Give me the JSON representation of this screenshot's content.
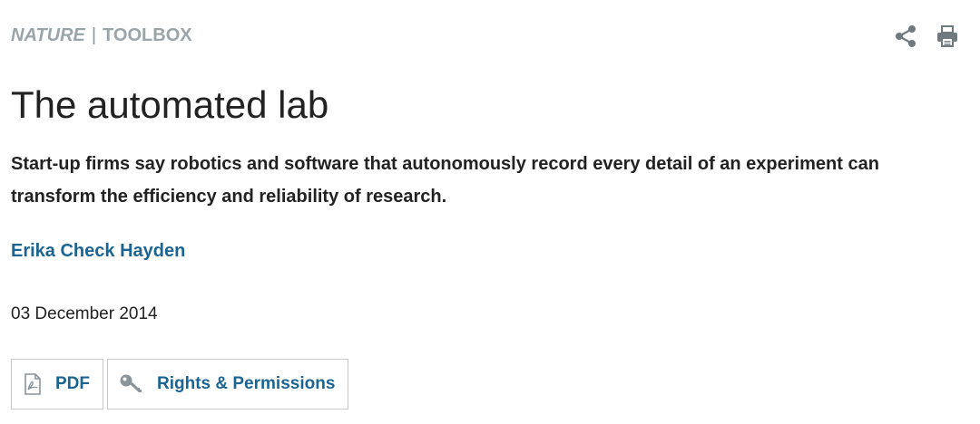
{
  "header": {
    "journal": "NATURE",
    "separator": "|",
    "section": "TOOLBOX",
    "share_icon": "share-icon",
    "print_icon": "print-icon"
  },
  "article": {
    "title": "The automated lab",
    "standfirst": "Start-up firms say robotics and software that autonomously record every detail of an experiment can transform the efficiency and reliability of research.",
    "author": "Erika Check Hayden",
    "date": "03 December 2014"
  },
  "tools": {
    "pdf_label": "PDF",
    "pdf_icon": "pdf-icon",
    "rights_label": "Rights & Permissions",
    "rights_icon": "key-icon"
  },
  "colors": {
    "kicker": "#9aa4ab",
    "link": "#1b6493",
    "text": "#222222",
    "icon": "#6f7a80",
    "border": "#c9c9c9"
  }
}
